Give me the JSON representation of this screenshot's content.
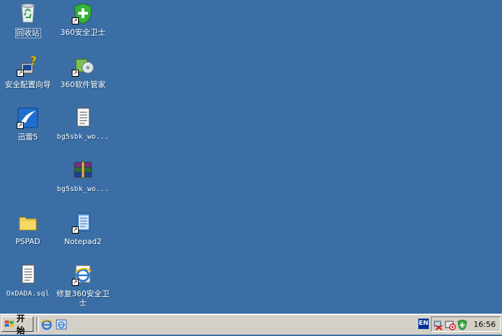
{
  "desktop": {
    "icons": [
      {
        "label": "回收站"
      },
      {
        "label": "360安全卫士"
      },
      {
        "label": "安全配置向导"
      },
      {
        "label": "360软件管家"
      },
      {
        "label": "迅雷5"
      },
      {
        "label": "bg5sbk_wo..."
      },
      {
        "label": "bg5sbk_wo..."
      },
      {
        "label": "PSPAD"
      },
      {
        "label": "Notepad2"
      },
      {
        "label": "OxDADA.sql"
      },
      {
        "label": "修复360安全卫士"
      }
    ]
  },
  "taskbar": {
    "start_label": "开始",
    "language": "EN",
    "clock": "16:56"
  },
  "colors": {
    "desktop_bg": "#3a6ea5",
    "taskbar_bg": "#d4d0c8"
  }
}
